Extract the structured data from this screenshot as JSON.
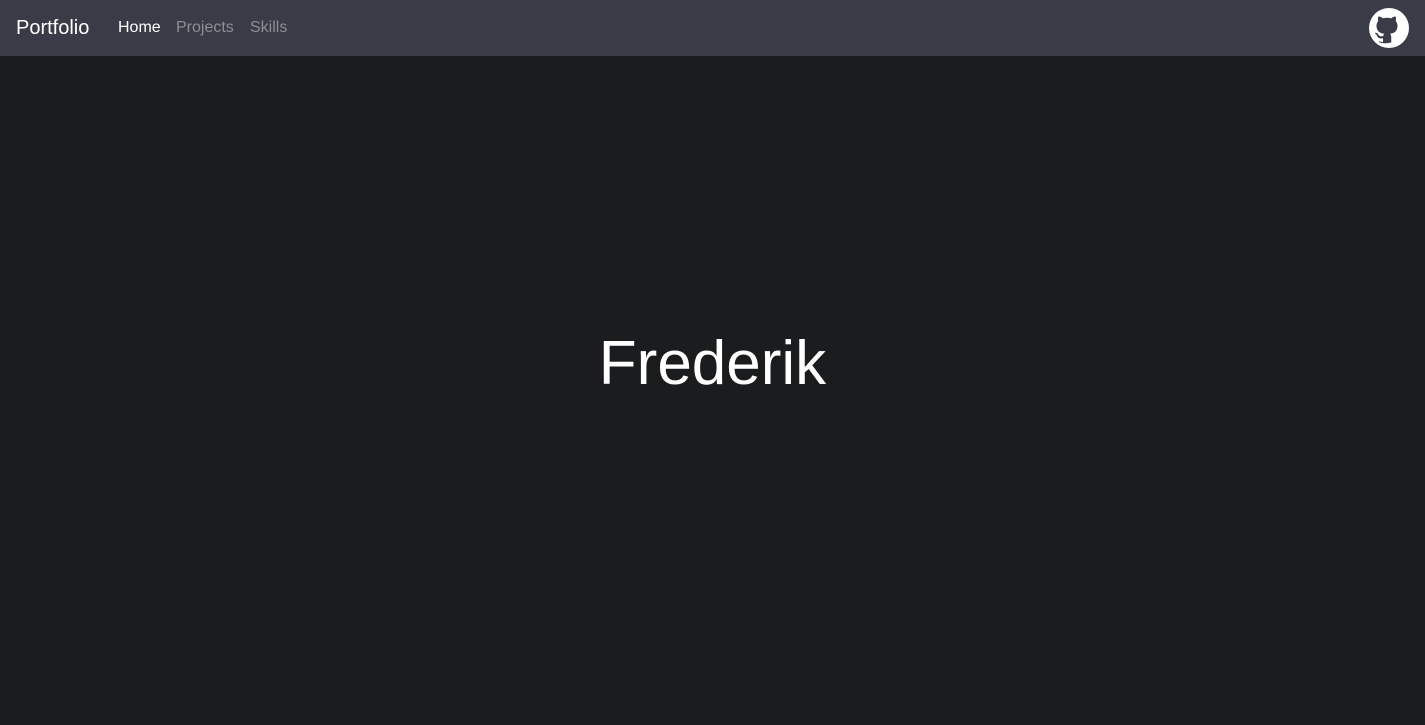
{
  "navbar": {
    "brand": "Portfolio",
    "links": [
      {
        "label": "Home",
        "active": true
      },
      {
        "label": "Projects",
        "active": false
      },
      {
        "label": "Skills",
        "active": false
      }
    ],
    "github_icon": "github-icon"
  },
  "hero": {
    "name": "Frederik"
  },
  "colors": {
    "navbar_bg": "#393c47",
    "page_bg": "#1b1c1e",
    "text_active": "#ffffff",
    "text_muted": "#8d8f94"
  }
}
